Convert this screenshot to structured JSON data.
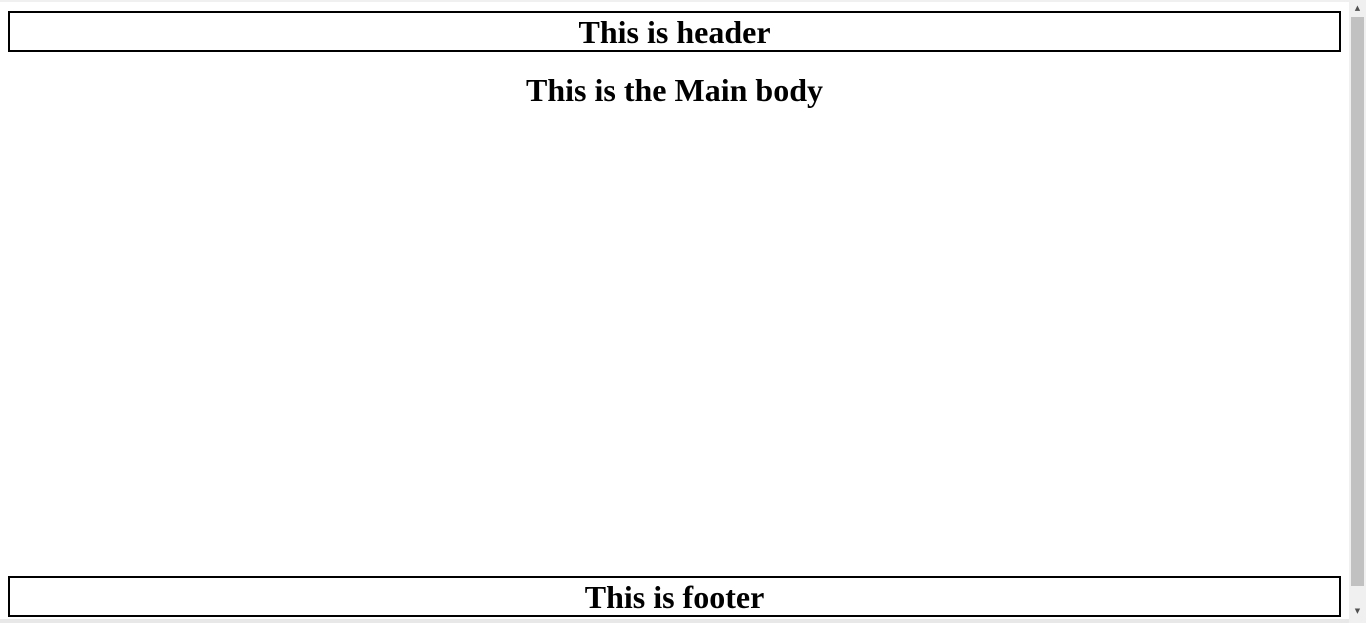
{
  "header": {
    "title": "This is header"
  },
  "main": {
    "title": "This is the Main body"
  },
  "footer": {
    "title": "This is footer"
  },
  "scrollbar": {
    "up_arrow": "▲",
    "down_arrow": "▼"
  }
}
